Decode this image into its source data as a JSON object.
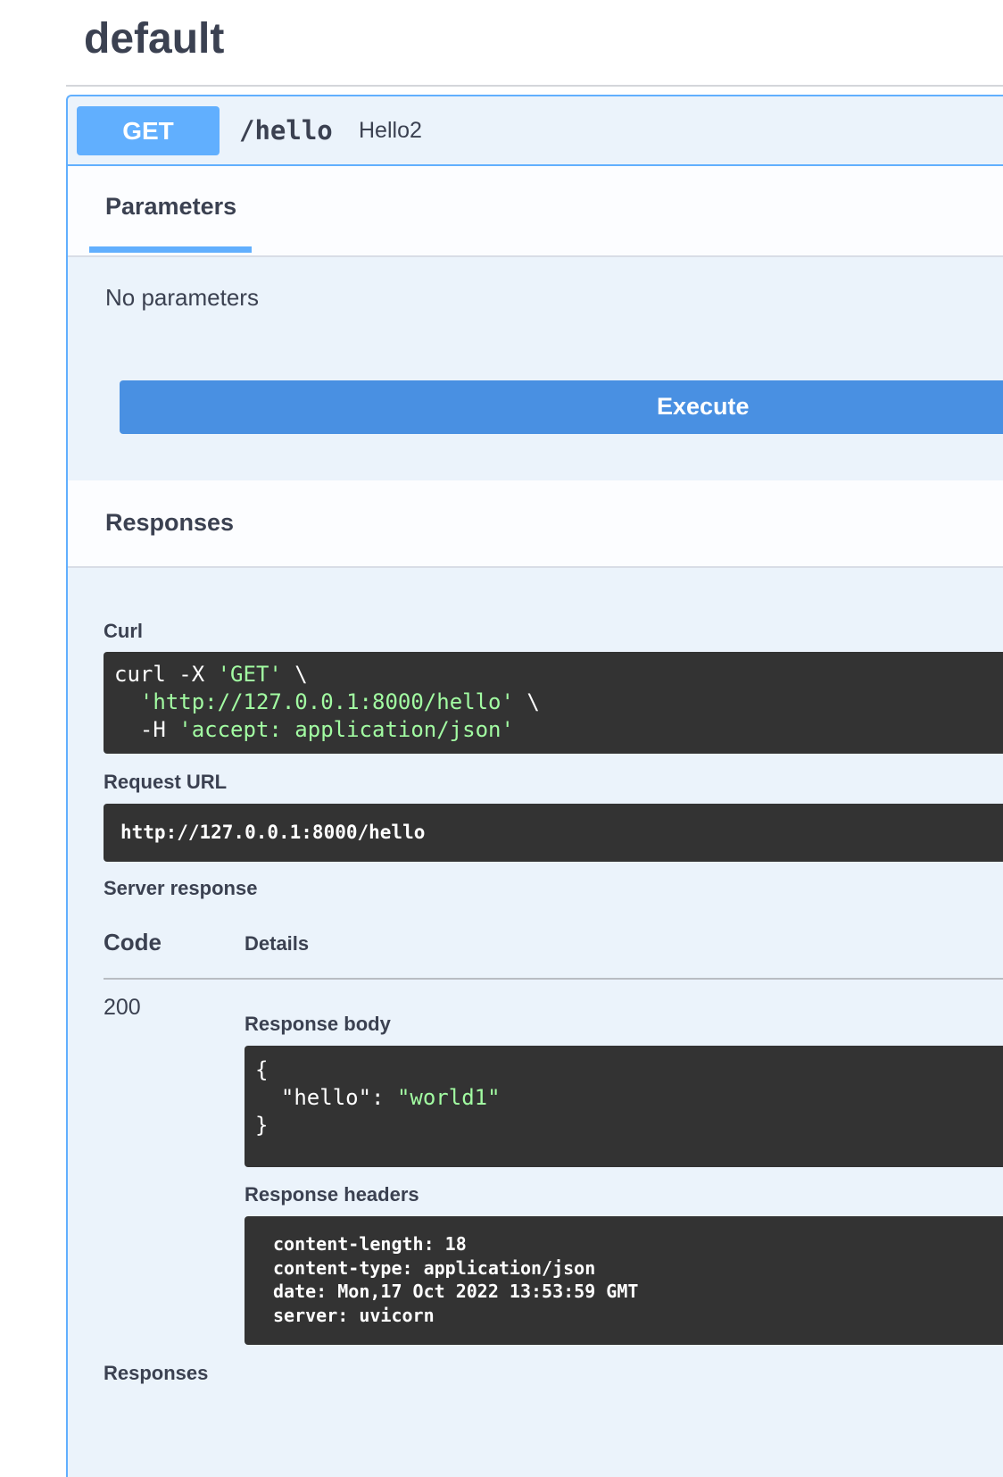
{
  "section": {
    "title": "default"
  },
  "operation": {
    "method": "GET",
    "path": "/hello",
    "summary": "Hello2"
  },
  "parameters": {
    "tab_label": "Parameters",
    "empty_text": "No parameters"
  },
  "execute": {
    "label": "Execute"
  },
  "responses_header": {
    "title": "Responses"
  },
  "curl": {
    "label": "Curl",
    "lines": [
      {
        "plain_before": "curl -X ",
        "string": "'GET'",
        "plain_after": " \\"
      },
      {
        "plain_before": "  ",
        "string": "'http://127.0.0.1:8000/hello'",
        "plain_after": " \\"
      },
      {
        "plain_before": "  -H ",
        "string": "'accept: application/json'",
        "plain_after": ""
      }
    ]
  },
  "request_url": {
    "label": "Request URL",
    "value": "http://127.0.0.1:8000/hello"
  },
  "server_response": {
    "label": "Server response",
    "code_header": "Code",
    "details_header": "Details",
    "status_code": "200",
    "body_label": "Response body",
    "body_lines": [
      {
        "plain_before": "{",
        "string": "",
        "plain_after": ""
      },
      {
        "plain_before": "  \"hello\": ",
        "string": "\"world1\"",
        "plain_after": ""
      },
      {
        "plain_before": "}",
        "string": "",
        "plain_after": ""
      }
    ],
    "headers_label": "Response headers",
    "headers_lines": [
      "content-length: 18",
      "content-type: application/json",
      "date: Mon,17 Oct 2022 13:53:59 GMT",
      "server: uvicorn"
    ]
  },
  "responses_footer": {
    "label": "Responses"
  },
  "colors": {
    "get_method": "#61affe",
    "execute_button": "#4990e2",
    "code_background": "#333333",
    "string_literal": "#a2fca2"
  }
}
